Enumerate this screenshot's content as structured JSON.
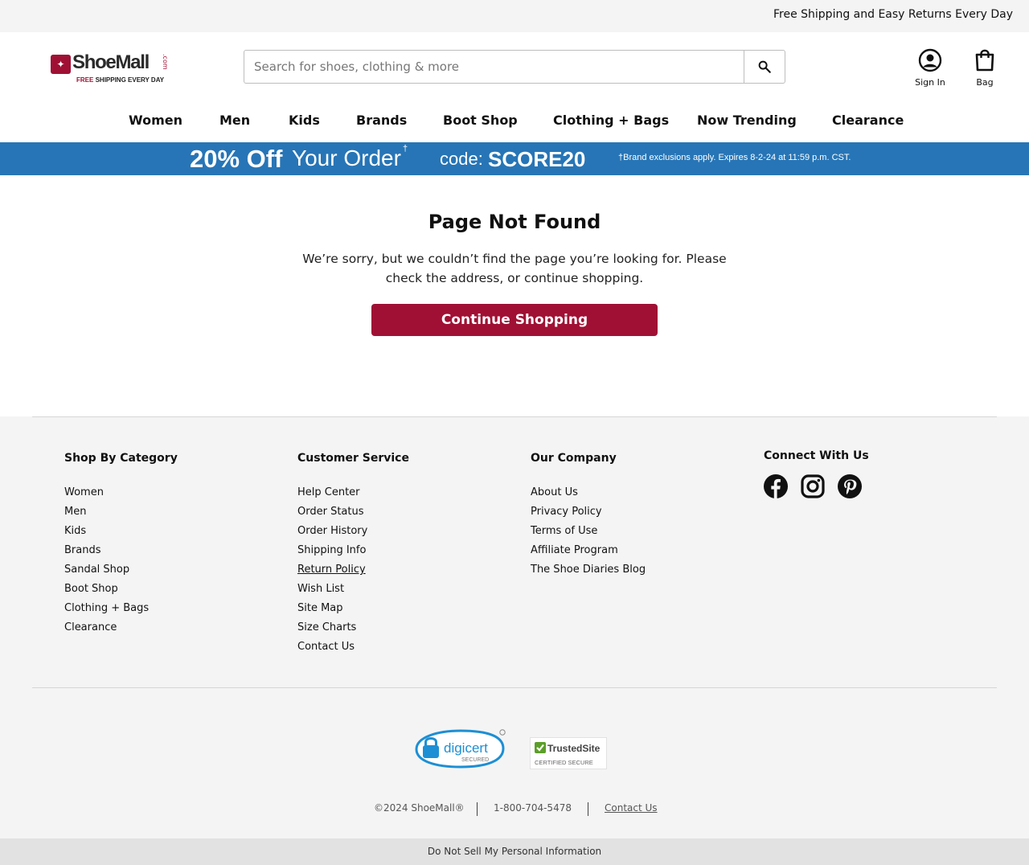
{
  "topbar": {
    "text": "Free Shipping and Easy Returns Every Day"
  },
  "logo": {
    "name": "ShoeMall",
    "com": ".com",
    "free": "FREE",
    "tagline": "SHIPPING EVERY DAY"
  },
  "search": {
    "placeholder": "Search for shoes, clothing & more",
    "value": ""
  },
  "header_actions": {
    "signin_label": "Sign In",
    "bag_label": "Bag"
  },
  "nav": [
    "Women",
    "Men",
    "Kids",
    "Brands",
    "Boot Shop",
    "Clothing + Bags",
    "Now Trending",
    "Clearance"
  ],
  "promo": {
    "percent": "20% Off",
    "order": "Your Order",
    "dagger": "†",
    "code_label": "code:",
    "code": "SCORE20",
    "note": "†Brand exclusions apply. Expires 8-2-24 at 11:59 p.m. CST.",
    "color": "#2775b6"
  },
  "main": {
    "title": "Page Not Found",
    "message": "We’re sorry, but we couldn’t find the page you’re looking for. Please check the address, or continue shopping.",
    "cta": "Continue Shopping",
    "cta_color": "#a01034"
  },
  "footer": {
    "shop": {
      "title": "Shop By Category",
      "items": [
        "Women",
        "Men",
        "Kids",
        "Brands",
        "Sandal Shop",
        "Boot Shop",
        "Clothing + Bags",
        "Clearance"
      ]
    },
    "service": {
      "title": "Customer Service",
      "items": [
        "Help Center",
        "Order Status",
        "Order History",
        "Shipping Info",
        "Return Policy",
        "Wish List",
        "Site Map",
        "Size Charts",
        "Contact Us"
      ]
    },
    "company": {
      "title": "Our Company",
      "items": [
        "About Us",
        "Privacy Policy",
        "Terms of Use",
        "Affiliate Program",
        "The Shoe Diaries Blog"
      ]
    },
    "connect": {
      "title": "Connect With Us",
      "icons": [
        "facebook-icon",
        "instagram-icon",
        "pinterest-icon"
      ]
    },
    "badges": {
      "digicert": "digicert",
      "digicert_sub": "SECURED",
      "trusted": "TrustedSite",
      "trusted_sub": "CERTIFIED SECURE"
    },
    "copyright": "©2024 ShoeMall®",
    "phone": "1-800-704-5478",
    "contact": "Contact Us",
    "do_not_sell": "Do Not Sell My Personal Information"
  }
}
